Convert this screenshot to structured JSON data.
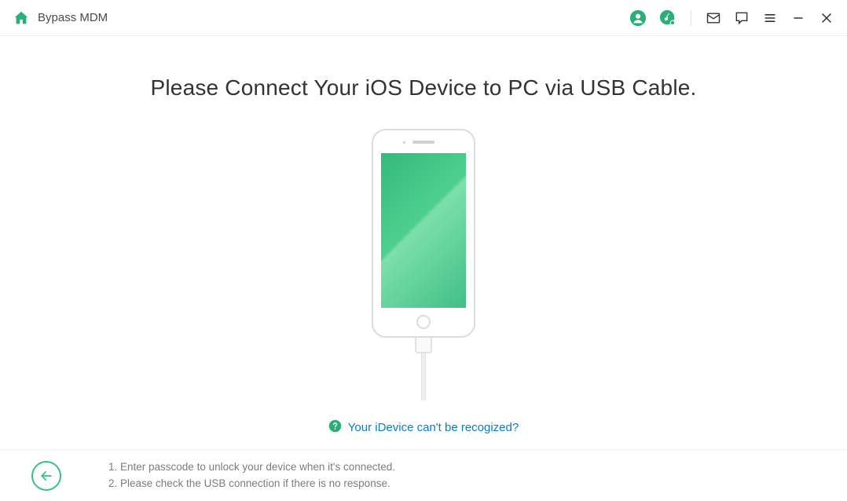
{
  "titlebar": {
    "title": "Bypass MDM"
  },
  "main": {
    "headline": "Please Connect Your iOS Device to PC via USB Cable."
  },
  "help": {
    "link_text": "Your iDevice can't be recogized?"
  },
  "footer": {
    "tip1": "1. Enter passcode to unlock your device when it's connected.",
    "tip2": "2. Please check the USB connection if there is no response."
  },
  "colors": {
    "accent": "#29b079",
    "link": "#0b7bd0"
  }
}
